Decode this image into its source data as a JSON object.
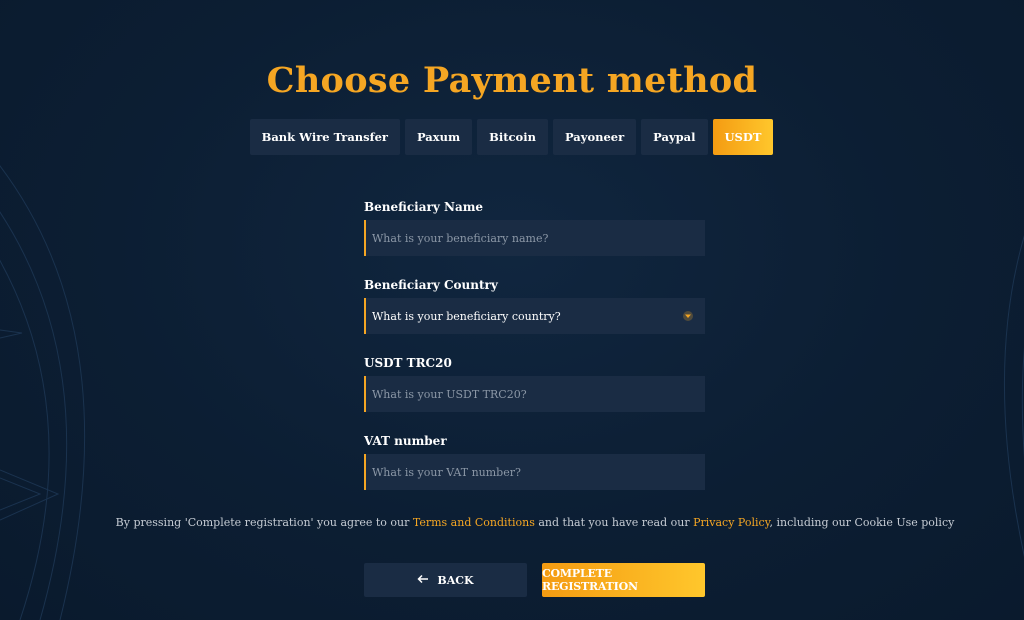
{
  "page": {
    "title": "Choose Payment method"
  },
  "tabs": [
    {
      "label": "Bank Wire Transfer",
      "active": false
    },
    {
      "label": "Paxum",
      "active": false
    },
    {
      "label": "Bitcoin",
      "active": false
    },
    {
      "label": "Payoneer",
      "active": false
    },
    {
      "label": "Paypal",
      "active": false
    },
    {
      "label": "USDT",
      "active": true
    }
  ],
  "form": {
    "beneficiary_name": {
      "label": "Beneficiary Name",
      "placeholder": "What is your beneficiary name?",
      "value": ""
    },
    "beneficiary_country": {
      "label": "Beneficiary Country",
      "selected": "What is your beneficiary country?",
      "icon": "caret-down-icon"
    },
    "usdt_trc20": {
      "label": "USDT TRC20",
      "placeholder": "What is your USDT TRC20?",
      "value": ""
    },
    "vat_number": {
      "label": "VAT number",
      "placeholder": "What is your VAT number?",
      "value": ""
    }
  },
  "consent": {
    "prefix": "By pressing 'Complete registration' you agree to our ",
    "terms_link": "Terms and Conditions",
    "middle": " and that you have read our ",
    "privacy_link": "Privacy Policy",
    "suffix": ", including our Cookie Use policy"
  },
  "buttons": {
    "back_label": "BACK",
    "back_icon": "arrow-left-icon",
    "complete_label": "COMPLETE REGISTRATION"
  },
  "colors": {
    "accent": "#f5a623",
    "background": "#0c1e33",
    "field": "#1a2c44"
  }
}
